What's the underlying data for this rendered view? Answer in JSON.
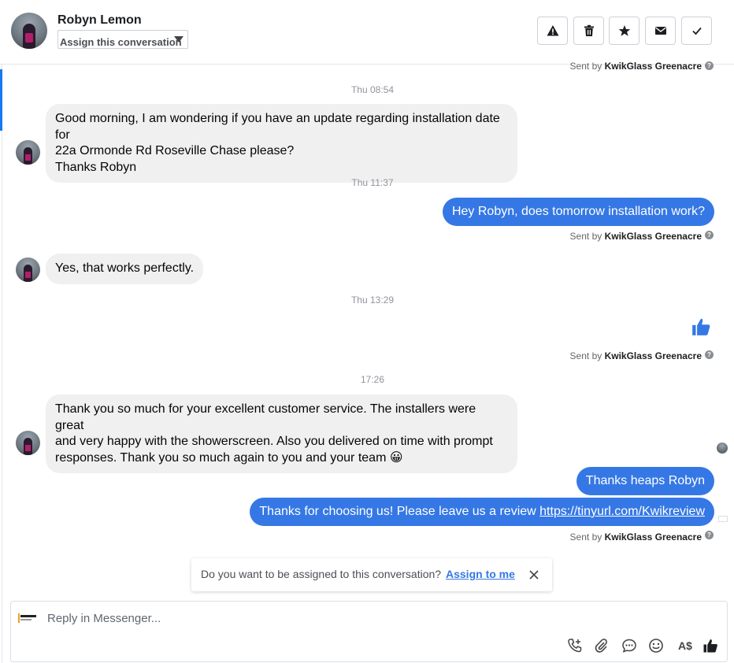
{
  "header": {
    "contact_name": "Robyn Lemon",
    "assign_label": "Assign this conversation",
    "actions": [
      {
        "name": "report",
        "icon": "warning-icon"
      },
      {
        "name": "delete",
        "icon": "trash-icon"
      },
      {
        "name": "star",
        "icon": "star-icon"
      },
      {
        "name": "mark-unread",
        "icon": "envelope-icon"
      },
      {
        "name": "mark-done",
        "icon": "check-icon"
      }
    ]
  },
  "conversation": {
    "top_sent_by_prefix": "Sent by",
    "top_sent_by_name": "KwikGlass Greenacre",
    "timestamps": [
      "Thu 08:54",
      "Thu 11:37",
      "Thu 13:29",
      "17:26"
    ],
    "messages": [
      {
        "from": "customer",
        "lines": [
          "Good morning, I am wondering if you have an update regarding installation date for",
          "22a Ormonde Rd Roseville Chase please?",
          "Thanks Robyn"
        ]
      },
      {
        "from": "business",
        "text": "Hey Robyn, does tomorrow installation work?"
      },
      {
        "from": "customer",
        "text": "Yes, that works perfectly."
      },
      {
        "from": "business",
        "type": "like",
        "icon": "thumbs-up-icon"
      },
      {
        "from": "customer",
        "lines": [
          "Thank you so much for your excellent customer service. The installers were great",
          "and very happy with the showerscreen. Also you delivered on time with prompt",
          "responses. Thank you so much again to you and your team 😀"
        ]
      },
      {
        "from": "business",
        "text": "Thanks heaps Robyn"
      },
      {
        "from": "business",
        "text": "Thanks for choosing us! Please leave us a review ",
        "link": "https://tinyurl.com/Kwikreview"
      }
    ],
    "sent_by_prefix": "Sent by",
    "sent_by_name": "KwikGlass Greenacre",
    "help_glyph": "?"
  },
  "assign_prompt": {
    "text": "Do you want to be assigned to this conversation?",
    "action": "Assign to me"
  },
  "composer": {
    "placeholder": "Reply in Messenger...",
    "tools": [
      "add-call-icon",
      "attachment-icon",
      "saved-reply-icon",
      "emoji-icon",
      "currency-icon",
      "like-icon"
    ],
    "currency_label": "A$"
  },
  "colors": {
    "outgoing": "#3578e5",
    "incoming": "#f0f0f0",
    "accent": "#1877f2"
  }
}
